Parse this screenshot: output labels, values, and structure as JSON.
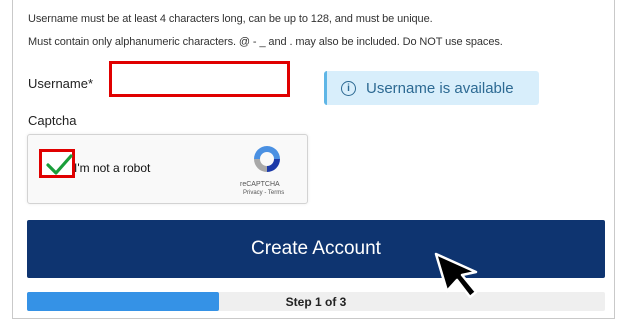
{
  "help_text": {
    "line1": "Username must be at least 4 characters long, can be up to 128, and must be unique.",
    "line2": "Must contain only alphanumeric characters. @ - _ and . may also be included. Do NOT use spaces."
  },
  "username": {
    "label": "Username*",
    "value": "",
    "placeholder": ""
  },
  "availability": {
    "icon": "info-icon",
    "text": "Username is available",
    "color": "#2d6a93",
    "background": "#d8eefb"
  },
  "captcha": {
    "label": "Captcha",
    "checkbox_label": "I'm not a robot",
    "checked": true,
    "brand": "reCAPTCHA",
    "privacy_link": "Privacy",
    "terms_link": "Terms",
    "separator": " - "
  },
  "submit": {
    "label": "Create Account",
    "color": "#0e3470"
  },
  "progress": {
    "label": "Step 1 of 3",
    "fraction": 0.333,
    "color": "#3592e6"
  },
  "highlight_color": "#e00000"
}
